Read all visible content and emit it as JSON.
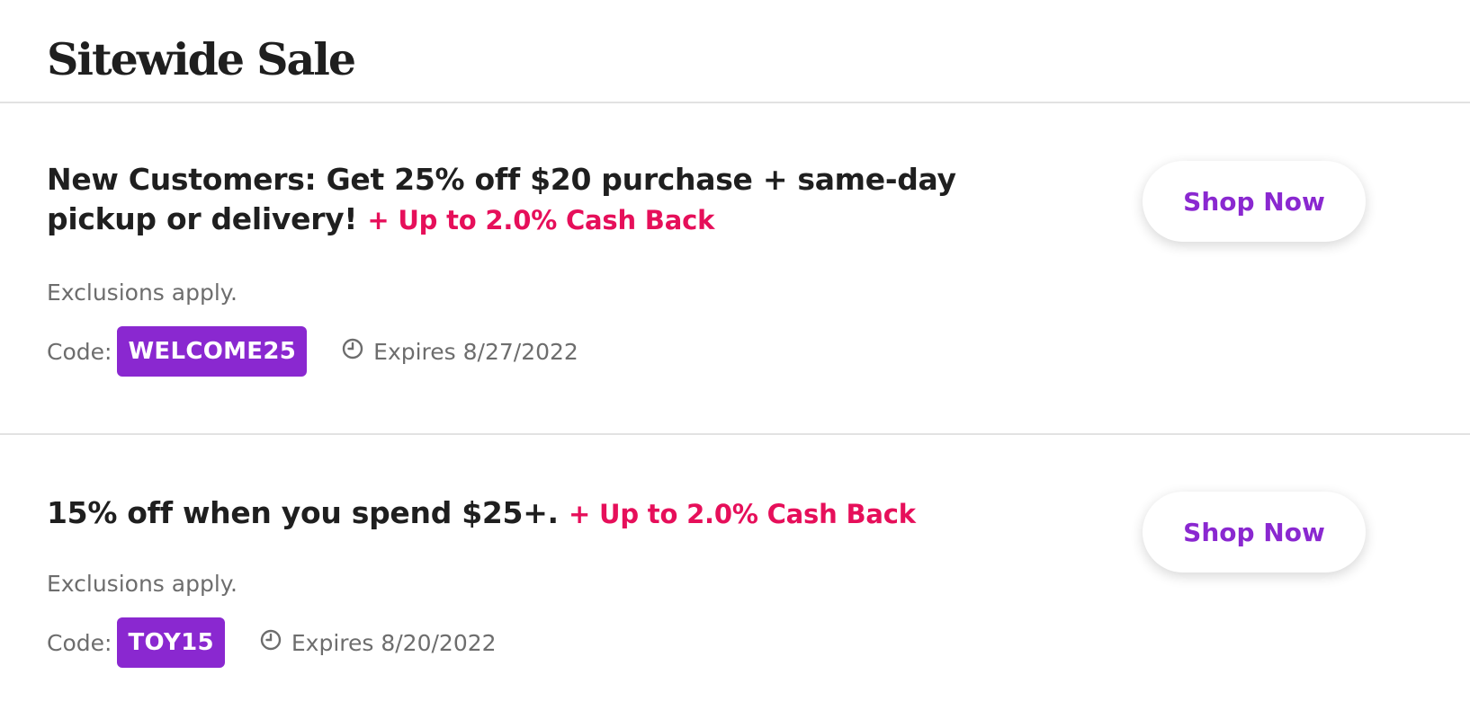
{
  "header": {
    "title": "Sitewide Sale"
  },
  "offers": [
    {
      "title": "New Customers: Get 25% off $20 purchase + same-day pickup or delivery!",
      "cashback": "+ Up to 2.0% Cash Back",
      "exclusions": "Exclusions apply.",
      "code_label": "Code:",
      "code": "WELCOME25",
      "expires": "Expires 8/27/2022",
      "cta": "Shop Now"
    },
    {
      "title": "15% off when you spend $25+.",
      "cashback": "+ Up to 2.0% Cash Back",
      "exclusions": "Exclusions apply.",
      "code_label": "Code:",
      "code": "TOY15",
      "expires": "Expires 8/20/2022",
      "cta": "Shop Now"
    }
  ],
  "colors": {
    "accent_purple": "#8a28d0",
    "cashback_pink": "#e60f5a",
    "muted_text": "#6d6d6d",
    "divider": "#e2e2e2"
  },
  "icons": {
    "expires_icon": "clock-icon"
  }
}
